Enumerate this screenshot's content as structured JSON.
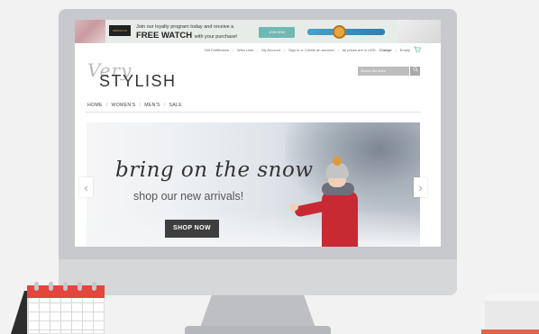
{
  "promo_banner": {
    "line1": "Join our loyalty program today and receive a",
    "line2_bold": "FREE WATCH",
    "line2_rest": "with your purchase!",
    "join_button": "JOIN NOW",
    "brand_mark": "WATCH CO"
  },
  "util_nav": {
    "links": [
      "Gift Certificates",
      "Wish Lists",
      "My Account",
      "Sign in or Create an account",
      "All prices are in USD",
      "Change",
      "Empty"
    ],
    "cart_icon": "cart-icon",
    "accent_color": "#6fb9b2"
  },
  "logo": {
    "script": "Very",
    "word": "STYLISH"
  },
  "search": {
    "placeholder": "Search the store",
    "icon": "search-icon"
  },
  "main_nav": {
    "items": [
      "HOME",
      "WOMEN'S",
      "MEN'S",
      "SALE"
    ],
    "separator": "/"
  },
  "hero": {
    "title": "bring on the snow",
    "subtitle": "shop our new arrivals!",
    "cta": "SHOP NOW",
    "prev_icon": "chevron-left-icon",
    "next_icon": "chevron-right-icon",
    "prev_glyph": "‹",
    "next_glyph": "›"
  }
}
